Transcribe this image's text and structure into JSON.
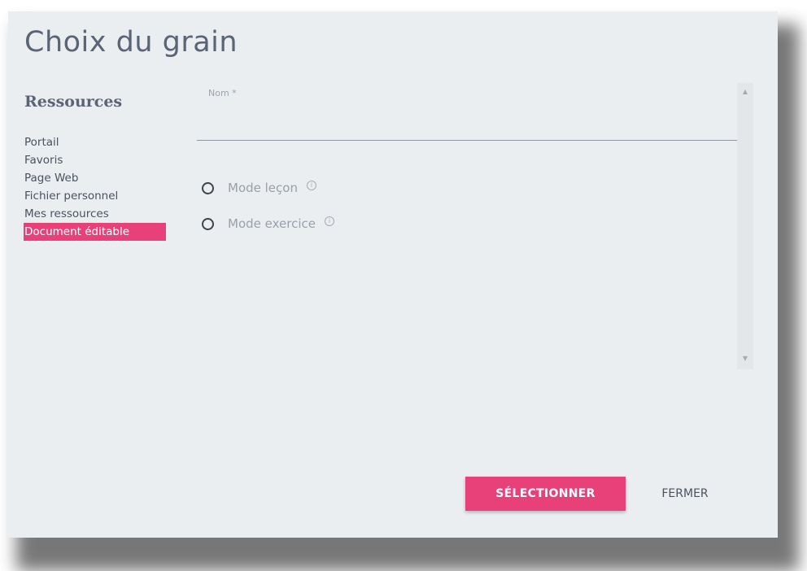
{
  "dialog": {
    "title": "Choix du grain"
  },
  "sidebar": {
    "heading": "Ressources",
    "items": [
      {
        "label": "Portail",
        "active": false
      },
      {
        "label": "Favoris",
        "active": false
      },
      {
        "label": "Page Web",
        "active": false
      },
      {
        "label": "Fichier personnel",
        "active": false
      },
      {
        "label": "Mes ressources",
        "active": false
      },
      {
        "label": "Document éditable",
        "active": true
      }
    ]
  },
  "form": {
    "name_label": "Nom *",
    "name_value": "",
    "mode_options": [
      {
        "label": "Mode leçon",
        "info_icon": "info-circle-icon",
        "selected": false
      },
      {
        "label": "Mode exercice",
        "info_icon": "info-circle-icon",
        "selected": false
      }
    ],
    "info_glyph": "i"
  },
  "scrollbar": {
    "up_glyph": "▲",
    "down_glyph": "▼"
  },
  "actions": {
    "select_label": "SÉLECTIONNER",
    "close_label": "FERMER"
  },
  "colors": {
    "accent": "#e8417a",
    "dialog_background": "#ebeef1",
    "title_text": "#5a6475"
  }
}
